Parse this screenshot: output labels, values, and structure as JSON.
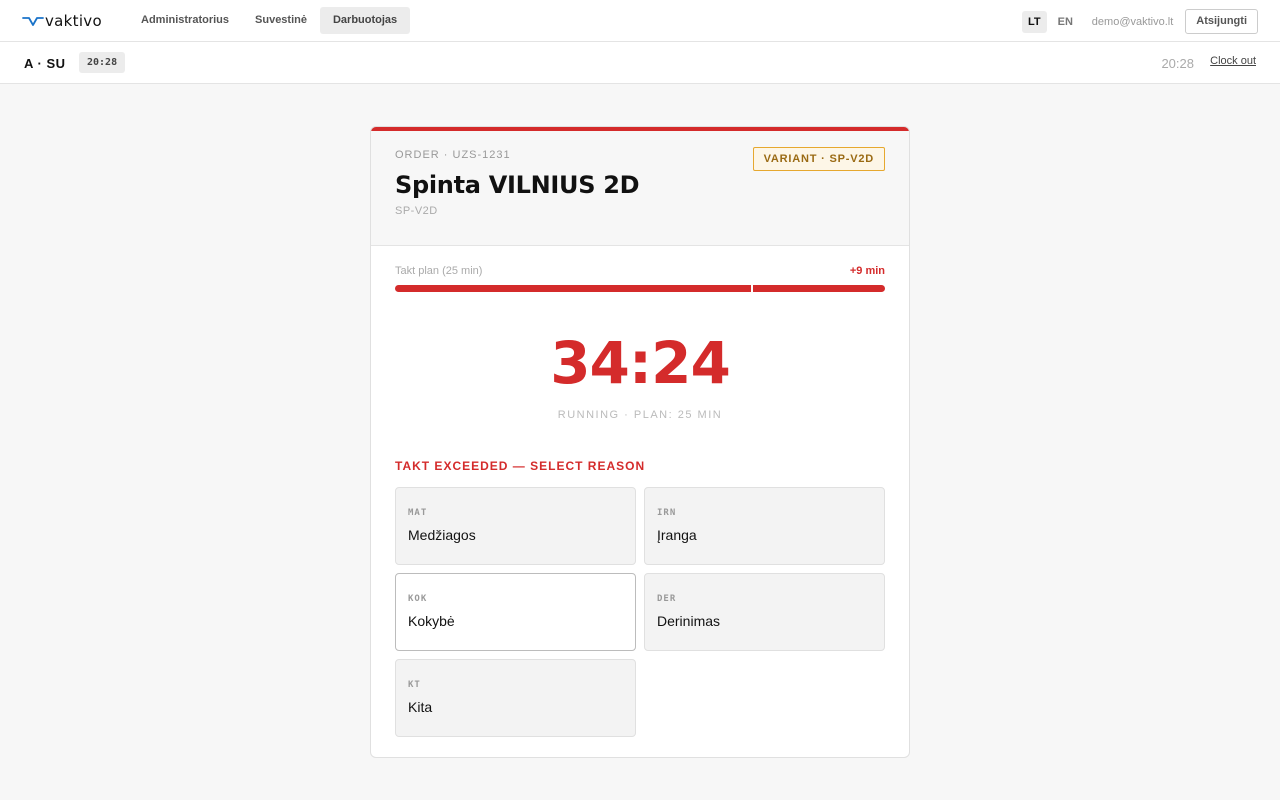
{
  "brand": {
    "logo_text": "vaktivo",
    "logo_icon": "wave-icon",
    "accent": "#1a73c9"
  },
  "nav": {
    "items": [
      {
        "label": "Administratorius",
        "active": false
      },
      {
        "label": "Suvestinė",
        "active": false
      },
      {
        "label": "Darbuotojas",
        "active": true
      }
    ]
  },
  "header_right": {
    "langs": [
      {
        "label": "LT",
        "active": true
      },
      {
        "label": "EN",
        "active": false
      }
    ],
    "email": "demo@vaktivo.lt",
    "logout_label": "Atsijungti"
  },
  "subbar": {
    "initials": "A · SU",
    "shift_time": "20:28",
    "clock": "20:28",
    "clock_out_label": "Clock out"
  },
  "card": {
    "order_label": "ORDER · UZS-1231",
    "product_name": "Spinta VILNIUS 2D",
    "sku": "SP-V2D",
    "variant_label": "VARIANT · SP-V2D",
    "takt_label": "Takt plan (25 min)",
    "takt_over": "+9 min",
    "takt_plan_min": 25,
    "elapsed_min": 34.4,
    "timer": "34:24",
    "timer_status": "RUNNING · PLAN: 25 MIN",
    "reason_title": "TAKT EXCEEDED — SELECT REASON",
    "reasons": [
      {
        "code": "MAT",
        "name": "Medžiagos"
      },
      {
        "code": "IRN",
        "name": "Įranga"
      },
      {
        "code": "KOK",
        "name": "Kokybė"
      },
      {
        "code": "DER",
        "name": "Derinimas"
      },
      {
        "code": "KT",
        "name": "Kita"
      }
    ]
  },
  "colors": {
    "danger": "#d42b2b",
    "variant_border": "#e6a82f",
    "variant_text": "#9a6a13"
  }
}
